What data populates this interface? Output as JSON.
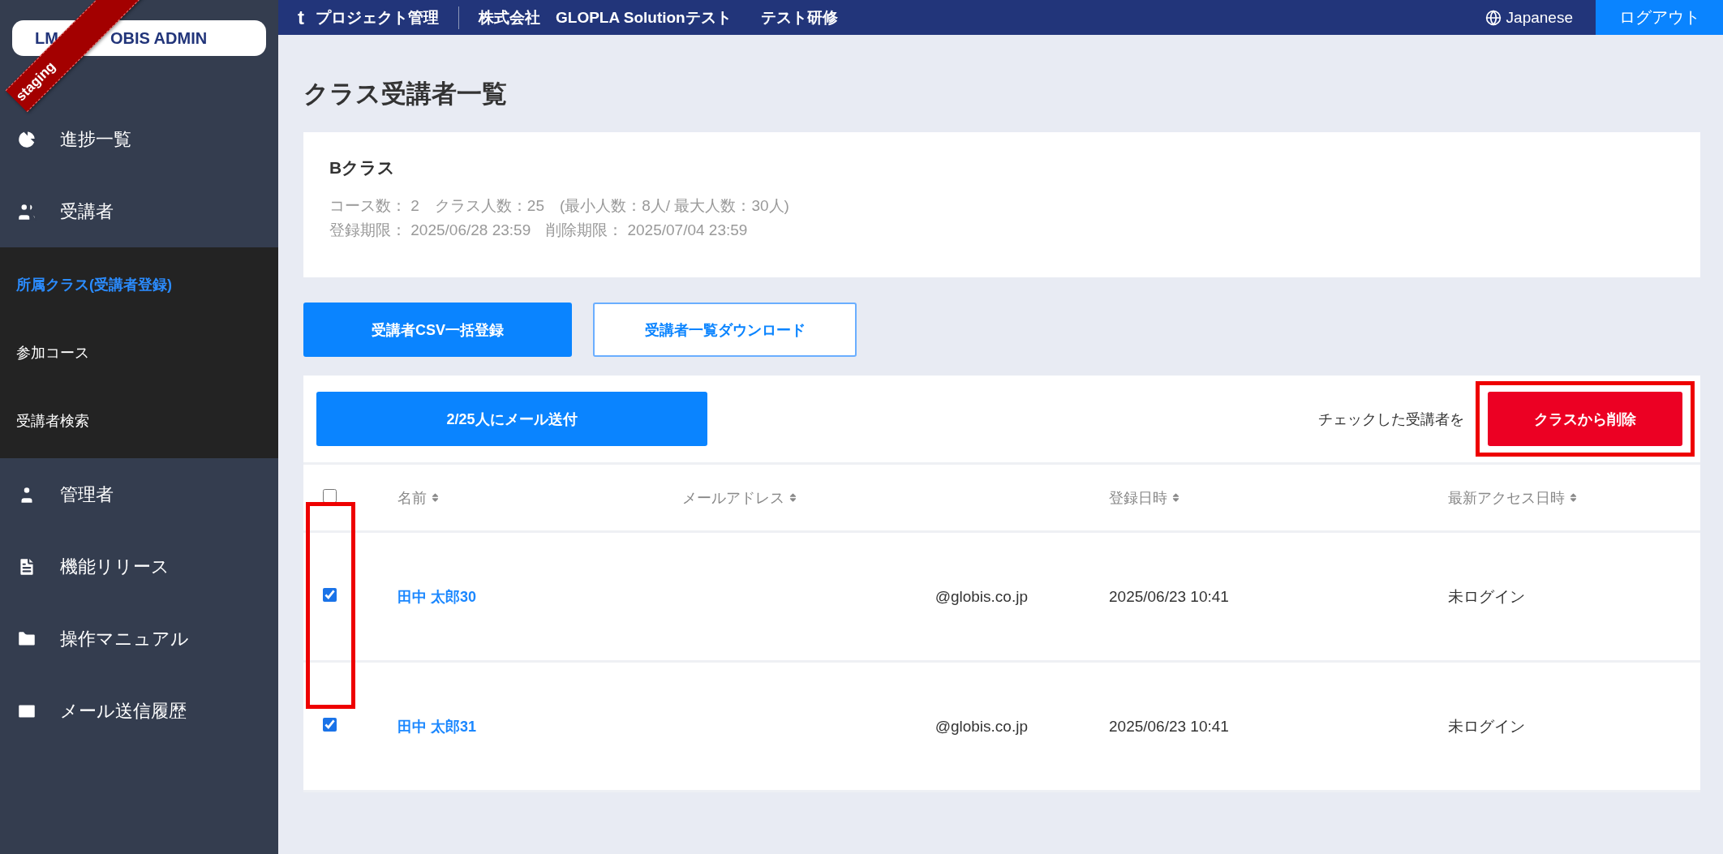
{
  "sidebar": {
    "logo": {
      "left": "LM",
      "right": "OBIS ADMIN"
    },
    "ribbon": "staging",
    "items": [
      {
        "kind": "main",
        "label": "進捗一覧",
        "selected": false
      },
      {
        "kind": "main",
        "label": "受講者",
        "selected": false
      },
      {
        "kind": "sub",
        "label": "所属クラス(受講者登録)",
        "selected": true
      },
      {
        "kind": "sub",
        "label": "参加コース",
        "selected": false
      },
      {
        "kind": "sub",
        "label": "受講者検索",
        "selected": false
      },
      {
        "kind": "main",
        "label": "管理者",
        "selected": false
      },
      {
        "kind": "main",
        "label": "機能リリース",
        "selected": false
      },
      {
        "kind": "main",
        "label": "操作マニュアル",
        "selected": false
      },
      {
        "kind": "main",
        "label": "メール送信履歴",
        "selected": false
      }
    ]
  },
  "topbar": {
    "mark": "t",
    "project": "プロジェクト管理",
    "company": "株式会社　GLOPLA Solutionテスト",
    "training": "テスト研修",
    "language": "Japanese",
    "logout": "ログアウト"
  },
  "page_title": "クラス受講者一覧",
  "class_card": {
    "name": "Bクラス",
    "line_1": "コース数： 2　クラス人数：25　(最小人数：8人/ 最大人数：30人)",
    "line_2": "登録期限： 2025/06/28 23:59　削除期限： 2025/07/04 23:59"
  },
  "actions": [
    {
      "kind": "primary",
      "label": "受講者CSV一括登録"
    },
    {
      "kind": "outline",
      "label": "受講者一覧ダウンロード"
    }
  ],
  "table": {
    "mail_button": "2/25人にメール送付",
    "checked_hint": "チェックした受講者を",
    "delete_button": "クラスから削除",
    "delete_highlighted": true,
    "header_checked": false,
    "columns": [
      "名前",
      "メールアドレス",
      "登録日時",
      "最新アクセス日時"
    ],
    "checkbox_highlighted": true,
    "rows": [
      {
        "checked": true,
        "name": "田中 太郎30",
        "email": "@globis.co.jp",
        "registered": "2025/06/23 10:41",
        "last_access": "未ログイン"
      },
      {
        "checked": true,
        "name": "田中 太郎31",
        "email": "@globis.co.jp",
        "registered": "2025/06/23 10:41",
        "last_access": "未ログイン"
      }
    ]
  }
}
